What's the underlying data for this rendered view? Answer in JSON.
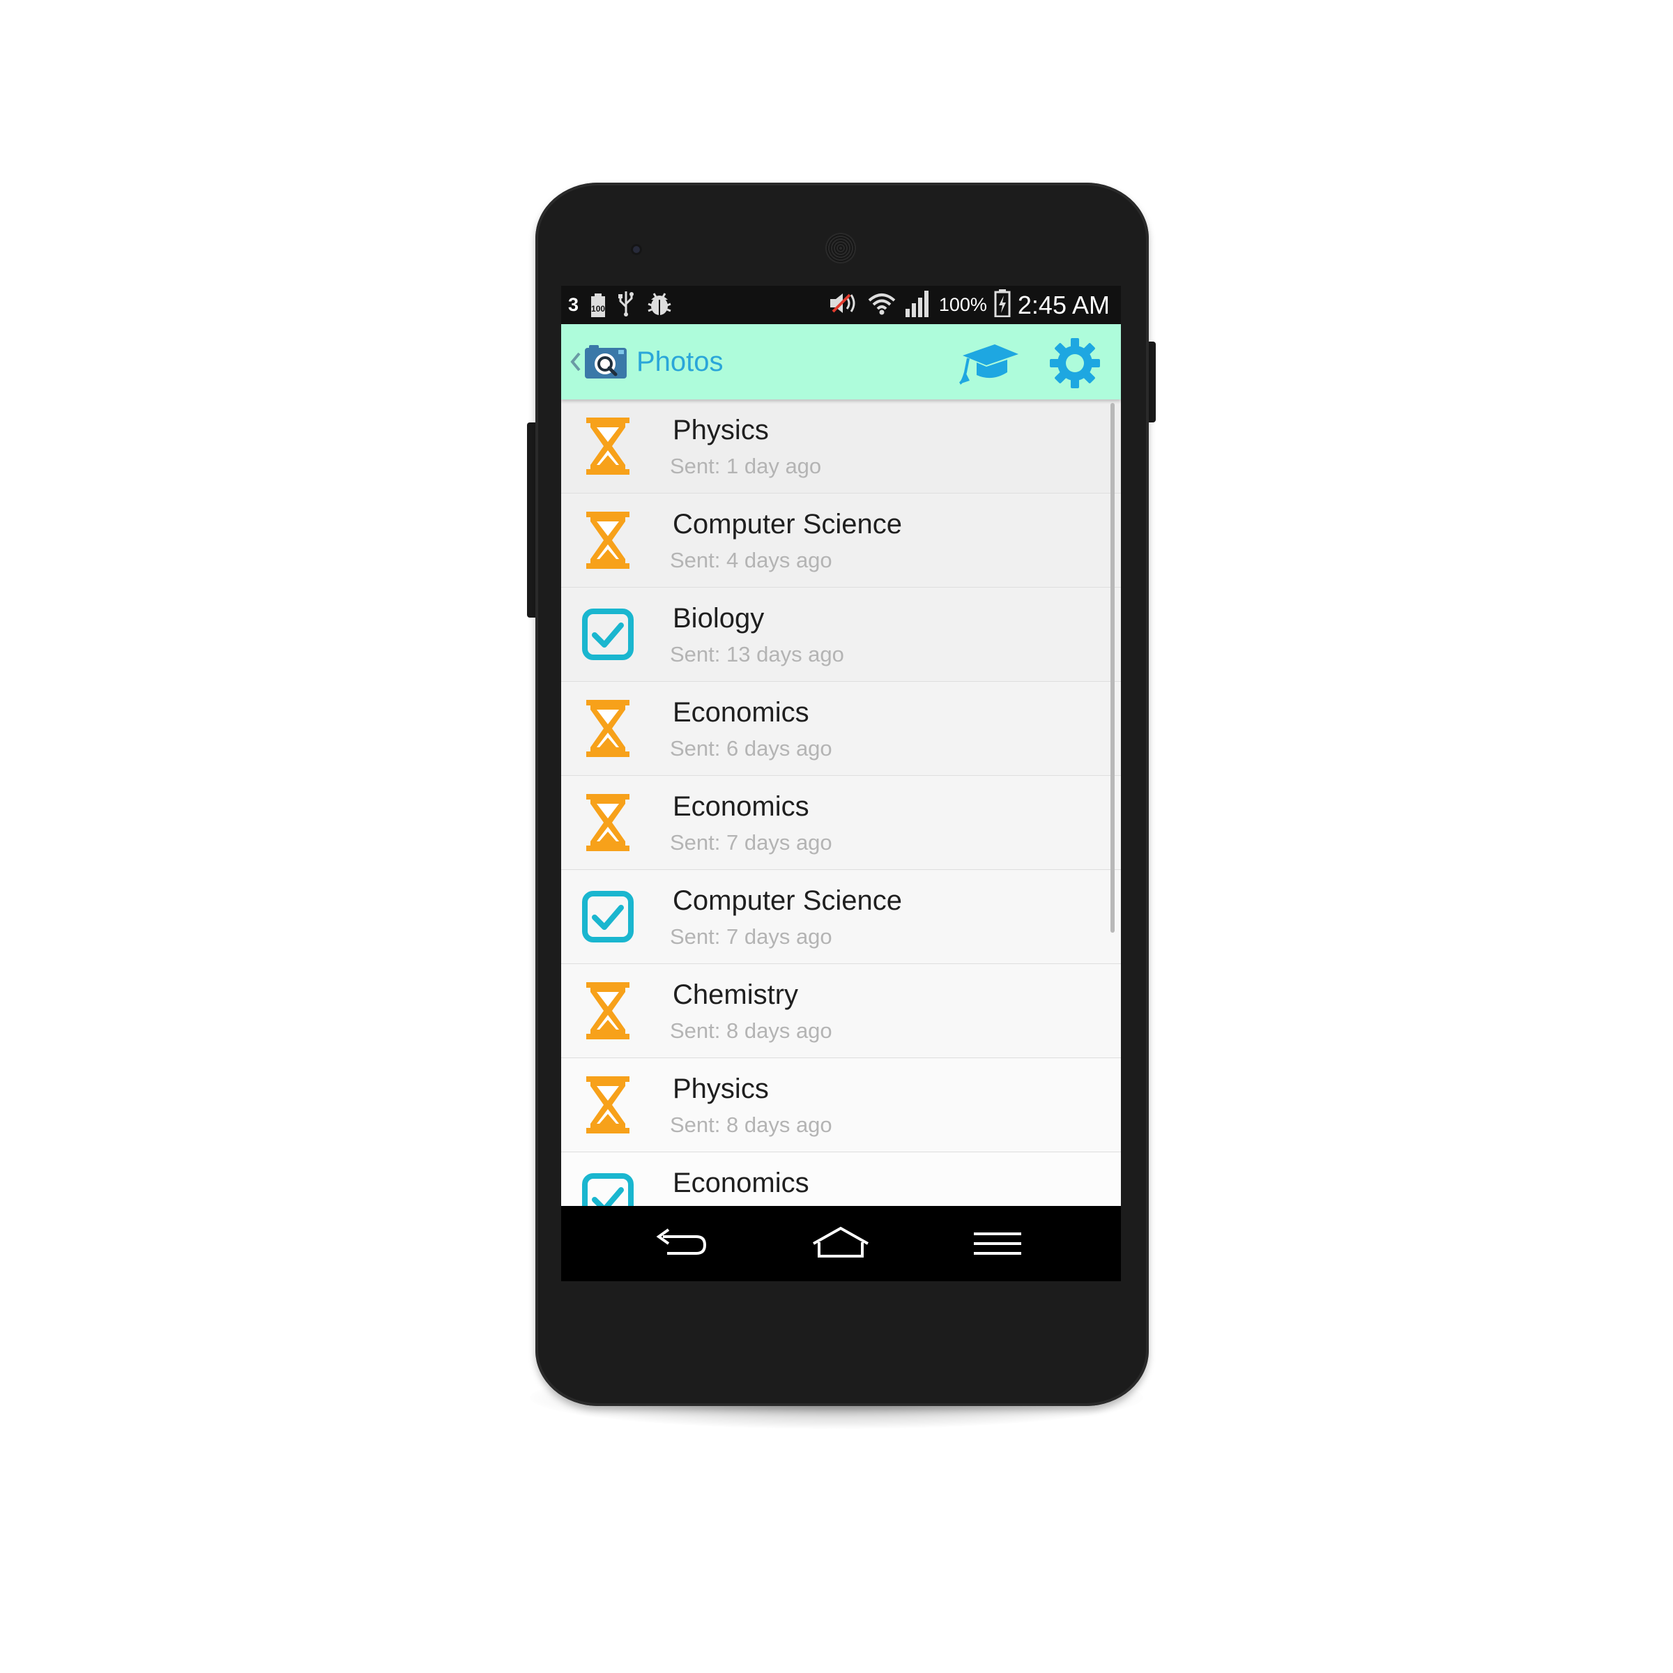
{
  "status_bar": {
    "notification_count": "3",
    "battery_badge": "100",
    "battery_percent": "100%",
    "time": "2:45 AM",
    "icons": [
      "battery-100-icon",
      "usb-icon",
      "debug-bug-icon",
      "volume-muted-icon",
      "wifi-icon",
      "signal-icon",
      "battery-charging-icon"
    ]
  },
  "action_bar": {
    "title": "Photos",
    "title_color": "#2aa6d9",
    "background": "#aefcdb",
    "icons": [
      "back-caret-icon",
      "camera-search-icon",
      "graduation-cap-icon",
      "gear-icon"
    ]
  },
  "items": [
    {
      "title": "Physics",
      "subtitle": "Sent: 1 day ago",
      "status": "pending"
    },
    {
      "title": "Computer Science",
      "subtitle": "Sent: 4 days ago",
      "status": "pending"
    },
    {
      "title": "Biology",
      "subtitle": "Sent: 13 days ago",
      "status": "done"
    },
    {
      "title": "Economics",
      "subtitle": "Sent: 6 days ago",
      "status": "pending"
    },
    {
      "title": "Economics",
      "subtitle": "Sent: 7 days ago",
      "status": "pending"
    },
    {
      "title": "Computer Science",
      "subtitle": "Sent: 7 days ago",
      "status": "done"
    },
    {
      "title": "Chemistry",
      "subtitle": "Sent: 8 days ago",
      "status": "pending"
    },
    {
      "title": "Physics",
      "subtitle": "Sent: 8 days ago",
      "status": "pending"
    },
    {
      "title": "Economics",
      "subtitle": "",
      "status": "done"
    }
  ],
  "status_colors": {
    "pending": "#f7a11a",
    "done": "#1ab6cf"
  },
  "nav_bar": {
    "icons": [
      "back-icon",
      "home-icon",
      "menu-icon"
    ]
  }
}
